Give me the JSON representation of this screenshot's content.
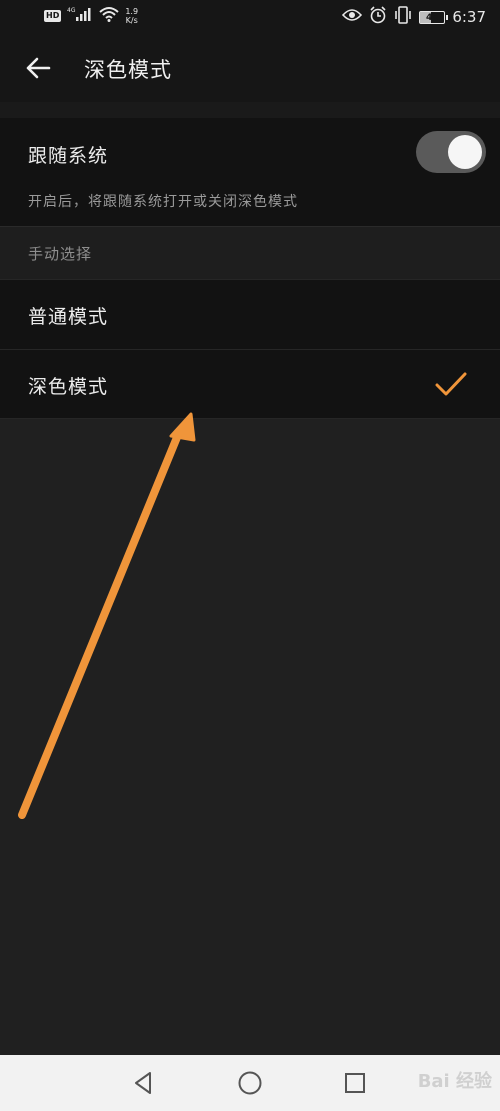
{
  "status_bar": {
    "hd_label": "HD",
    "network_type": "4G",
    "net_speed_value": "1.9",
    "net_speed_unit": "K/s",
    "battery_level": "46",
    "time": "6:37",
    "icons": [
      "signal-icon",
      "wifi-icon",
      "eye-icon",
      "alarm-icon",
      "vibrate-icon",
      "battery-icon"
    ]
  },
  "app_bar": {
    "back_icon": "back-arrow-icon",
    "title": "深色模式"
  },
  "follow_system": {
    "label": "跟随系统",
    "description": "开启后，将跟随系统打开或关闭深色模式",
    "toggle_on": true
  },
  "manual_section": {
    "header": "手动选择",
    "options": [
      {
        "label": "普通模式",
        "selected": false
      },
      {
        "label": "深色模式",
        "selected": true
      }
    ]
  },
  "nav_bar": {
    "buttons": [
      "nav-back-icon",
      "nav-home-icon",
      "nav-recent-icon"
    ],
    "watermark": "Bai 经验"
  },
  "colors": {
    "background": "#202020",
    "card": "#121212",
    "accent": "#f0953a",
    "annotation_arrow": "#f0953a"
  }
}
